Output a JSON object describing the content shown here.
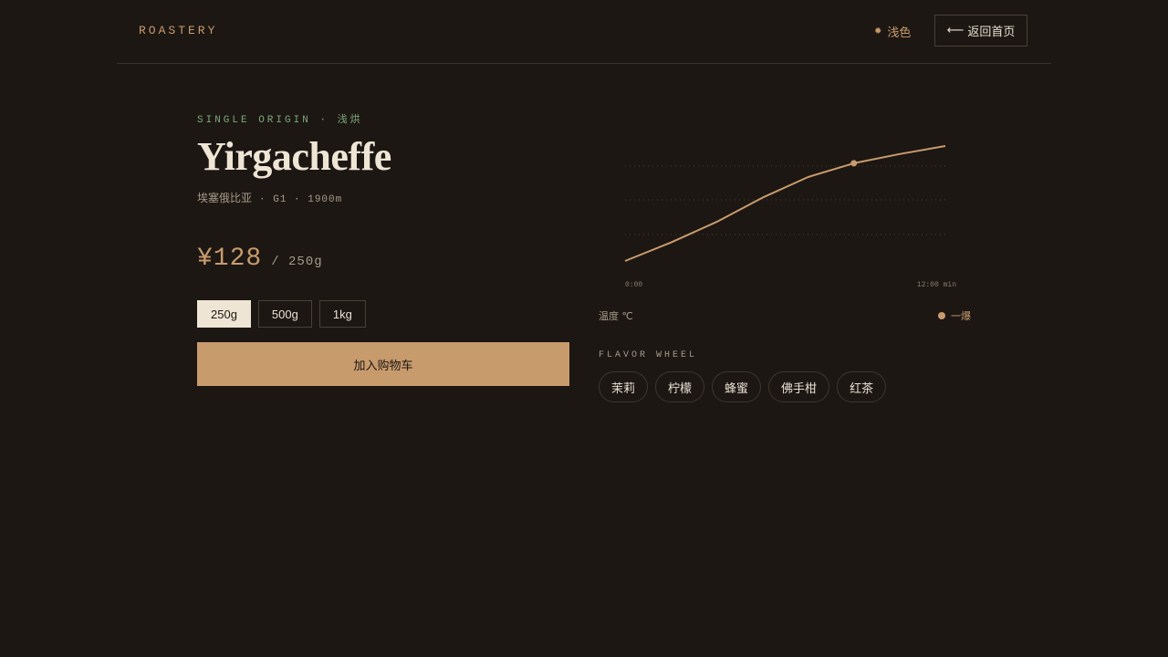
{
  "header": {
    "brand": "ROASTERY",
    "theme_icon": "sun-icon",
    "theme_label": "浅色",
    "home_icon": "arrow-left-icon",
    "home_label": "返回首页"
  },
  "product": {
    "eyebrow": "SINGLE ORIGIN · 浅烘",
    "name": "Yirgacheffe",
    "origin_country": "埃塞俄比亚",
    "grade_altitude": "· G1 · 1900m",
    "price": "¥128",
    "price_unit": "/ 250g",
    "sizes": [
      "250g",
      "500g",
      "1kg"
    ],
    "selected_size": "250g",
    "cart_label": "加入购物车"
  },
  "roast_chart": {
    "y_label": "温度 ℃",
    "legend_label": "一爆",
    "x_start_label": "0:00",
    "x_end_label": "12:00 min"
  },
  "chart_data": {
    "type": "line",
    "x": [
      0,
      1,
      2,
      3,
      4,
      5,
      6,
      7
    ],
    "values": [
      0,
      0.16,
      0.34,
      0.55,
      0.73,
      0.85,
      0.93,
      1.0
    ],
    "marker_index": 5,
    "xlabel": "",
    "ylabel": "温度 ℃",
    "grid": "dotted horizontal",
    "series": [
      {
        "name": "一爆",
        "values": [
          0,
          0.16,
          0.34,
          0.55,
          0.73,
          0.85,
          0.93,
          1.0
        ]
      }
    ]
  },
  "flavor": {
    "title": "FLAVOR WHEEL",
    "notes": [
      "茉莉",
      "柠檬",
      "蜂蜜",
      "佛手柑",
      "红茶"
    ]
  },
  "colors": {
    "background": "#1c1713",
    "accent": "#c89b6d",
    "green": "#7ea87a",
    "text": "#efe5d5"
  }
}
